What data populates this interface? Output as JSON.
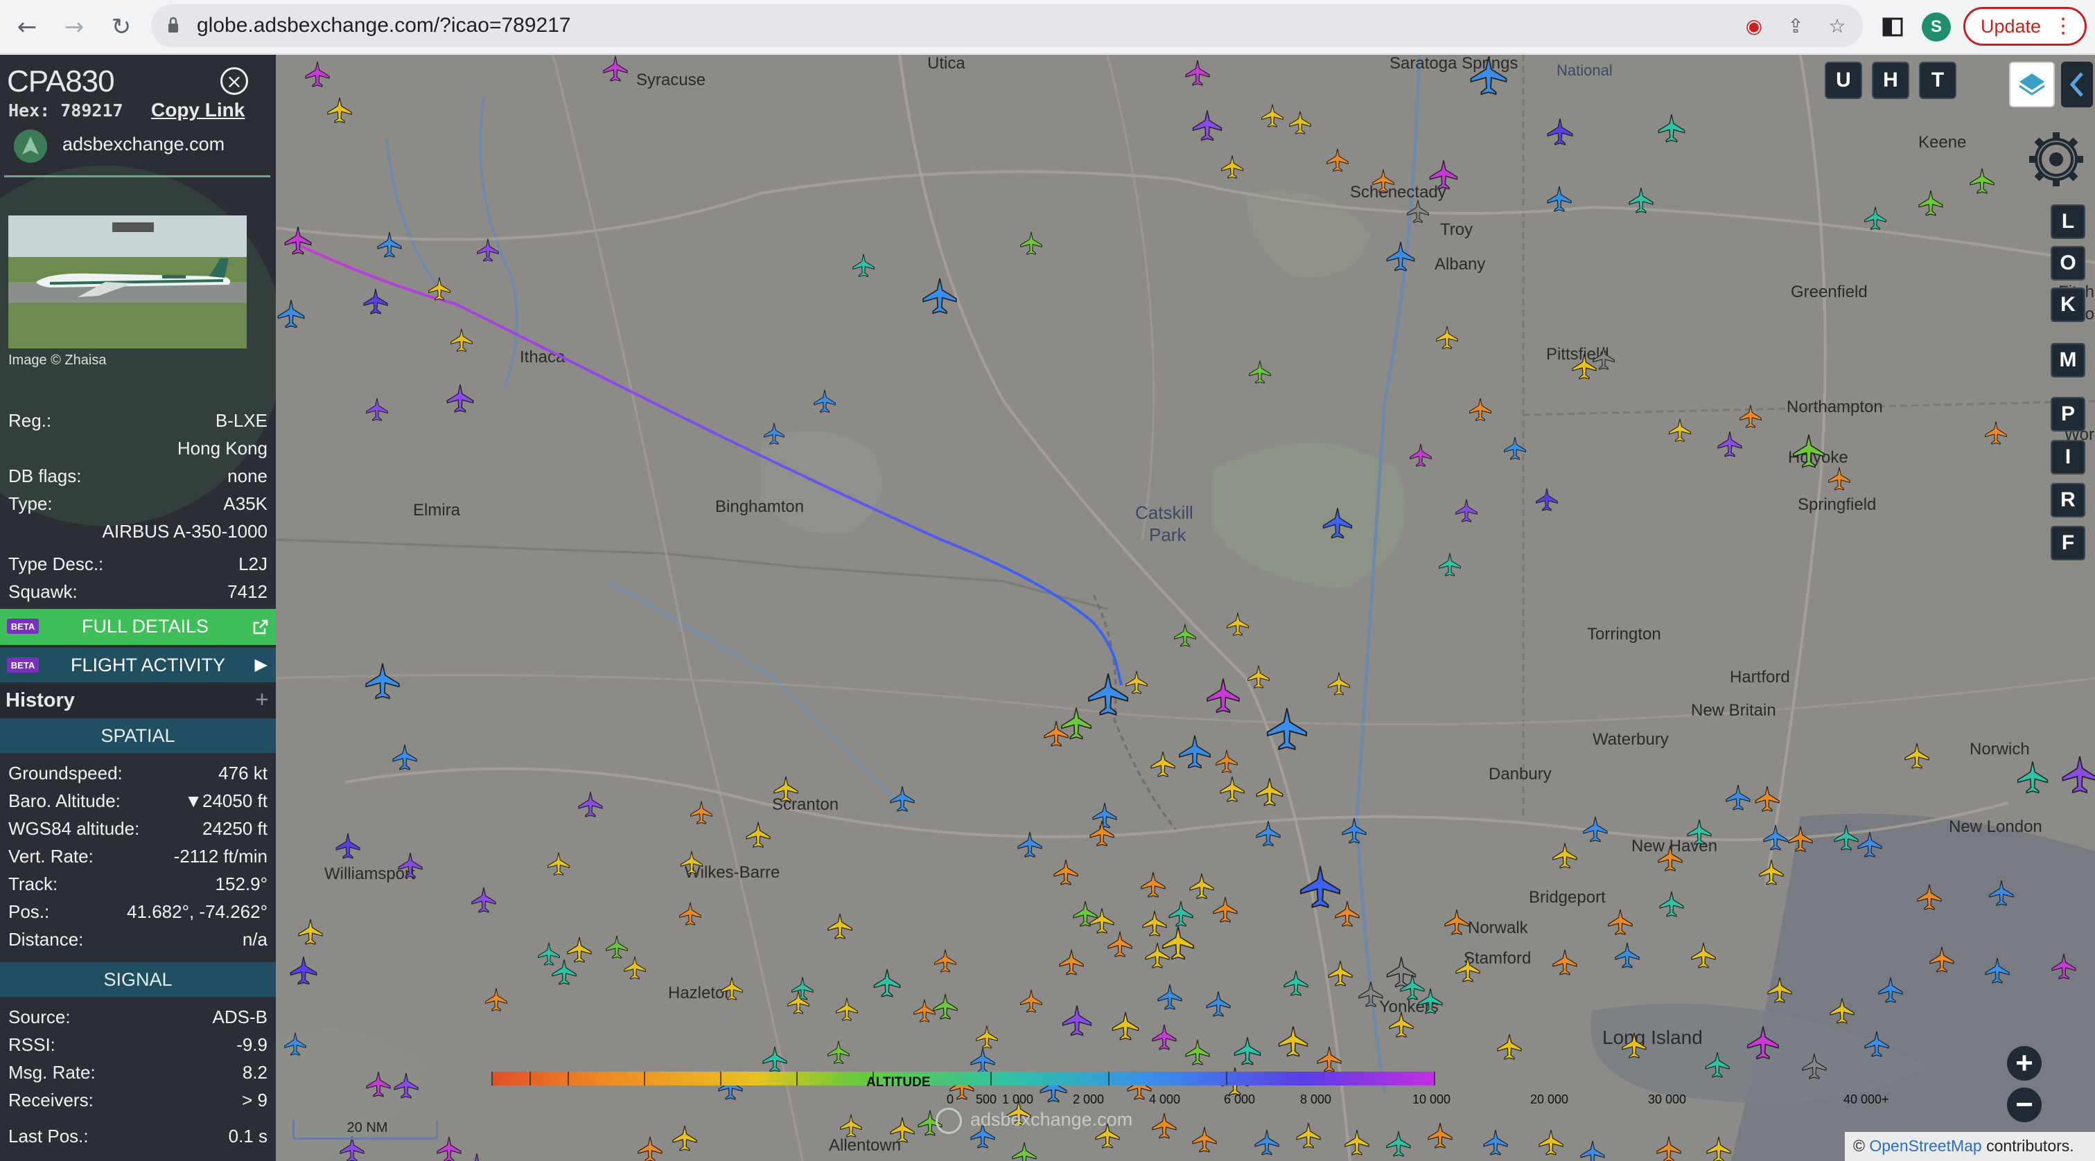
{
  "browser": {
    "url": "globe.adsbexchange.com/?icao=789217",
    "profile_initial": "S",
    "update_label": "Update",
    "icons": [
      "back-arrow-icon",
      "forward-arrow-icon",
      "reload-icon",
      "lock-icon",
      "blocked-cookie-icon",
      "share-icon",
      "star-icon",
      "sidebar-icon",
      "more-vert-icon"
    ]
  },
  "sidebar": {
    "callsign": "CPA830",
    "hex_label": "Hex: 789217",
    "copy_link": "Copy Link",
    "site_name": "adsbexchange.com",
    "photo_credit": "Image © Zhaisa",
    "details": {
      "reg_label": "Reg.:",
      "reg_value": "B-LXE",
      "country": "Hong Kong",
      "dbflags_label": "DB flags:",
      "dbflags_value": "none",
      "type_label": "Type:",
      "type_value": "A35K",
      "type_full": "AIRBUS A-350-1000",
      "typedesc_label": "Type Desc.:",
      "typedesc_value": "L2J",
      "squawk_label": "Squawk:",
      "squawk_value": "7412"
    },
    "full_details": {
      "badge": "BETA",
      "label": "FULL DETAILS"
    },
    "flight_activity": {
      "badge": "BETA",
      "label": "FLIGHT ACTIVITY"
    },
    "history": {
      "title": "History",
      "plus": "+"
    },
    "spatial": {
      "title": "SPATIAL",
      "groundspeed_label": "Groundspeed:",
      "groundspeed_value": "476 kt",
      "baro_label": "Baro. Altitude:",
      "baro_value": "▼24050 ft",
      "wgs_label": "WGS84 altitude:",
      "wgs_value": "24250 ft",
      "vrate_label": "Vert. Rate:",
      "vrate_value": "-2112 ft/min",
      "track_label": "Track:",
      "track_value": "152.9°",
      "pos_label": "Pos.:",
      "pos_value": "41.682°, -74.262°",
      "distance_label": "Distance:",
      "distance_value": "n/a"
    },
    "signal": {
      "title": "SIGNAL",
      "source_label": "Source:",
      "source_value": "ADS-B",
      "rssi_label": "RSSI:",
      "rssi_value": "-9.9",
      "msgrate_label": "Msg. Rate:",
      "msgrate_value": "8.2",
      "receivers_label": "Receivers:",
      "receivers_value": "> 9",
      "lastpos_label": "Last Pos.:",
      "lastpos_value": "0.1 s"
    }
  },
  "map": {
    "top_buttons": [
      "U",
      "H",
      "T"
    ],
    "side_buttons": [
      "L",
      "O",
      "K",
      "M",
      "P",
      "I",
      "R",
      "F"
    ],
    "place_labels": [
      "Syracuse",
      "Utica",
      "Saratoga Springs",
      "Schenectady",
      "Troy",
      "Albany",
      "Keene",
      "Ithaca",
      "Binghamton",
      "Elmira",
      "Catskill",
      "Park",
      "Greenfield",
      "Pittsfield",
      "Northampton",
      "Holyoke",
      "Springfield",
      "Torrington",
      "Hartford",
      "New Britain",
      "Waterbury",
      "Norwich",
      "Danbury",
      "New Haven",
      "New London",
      "Bridgeport",
      "Norwalk",
      "Stamford",
      "Yonkers",
      "Scranton",
      "Wilkes-Barre",
      "Hazleton",
      "Williamsport",
      "Allentown",
      "Long Island",
      "National",
      "Fitch",
      "Leo",
      "Wor"
    ],
    "altitude_legend": {
      "label": "ALTITUDE",
      "ticks": [
        "0",
        "500",
        "1 000",
        "2 000",
        "4 000",
        "6 000",
        "8 000",
        "10 000",
        "20 000",
        "30 000",
        "40 000+"
      ]
    },
    "scale": "20 NM",
    "watermark": "adsbexchange.com",
    "attribution_prefix": "©",
    "attribution_link": "OpenStreetMap",
    "attribution_suffix": "contributors.",
    "colors": {
      "map_bg": "#8d8b87",
      "sidebar_bg": "#2b2f35",
      "beta_green": "#3fbf5a",
      "section_head": "#1f4f60",
      "trail_start": "#c83ad6",
      "trail_end": "#3a63f0"
    }
  }
}
